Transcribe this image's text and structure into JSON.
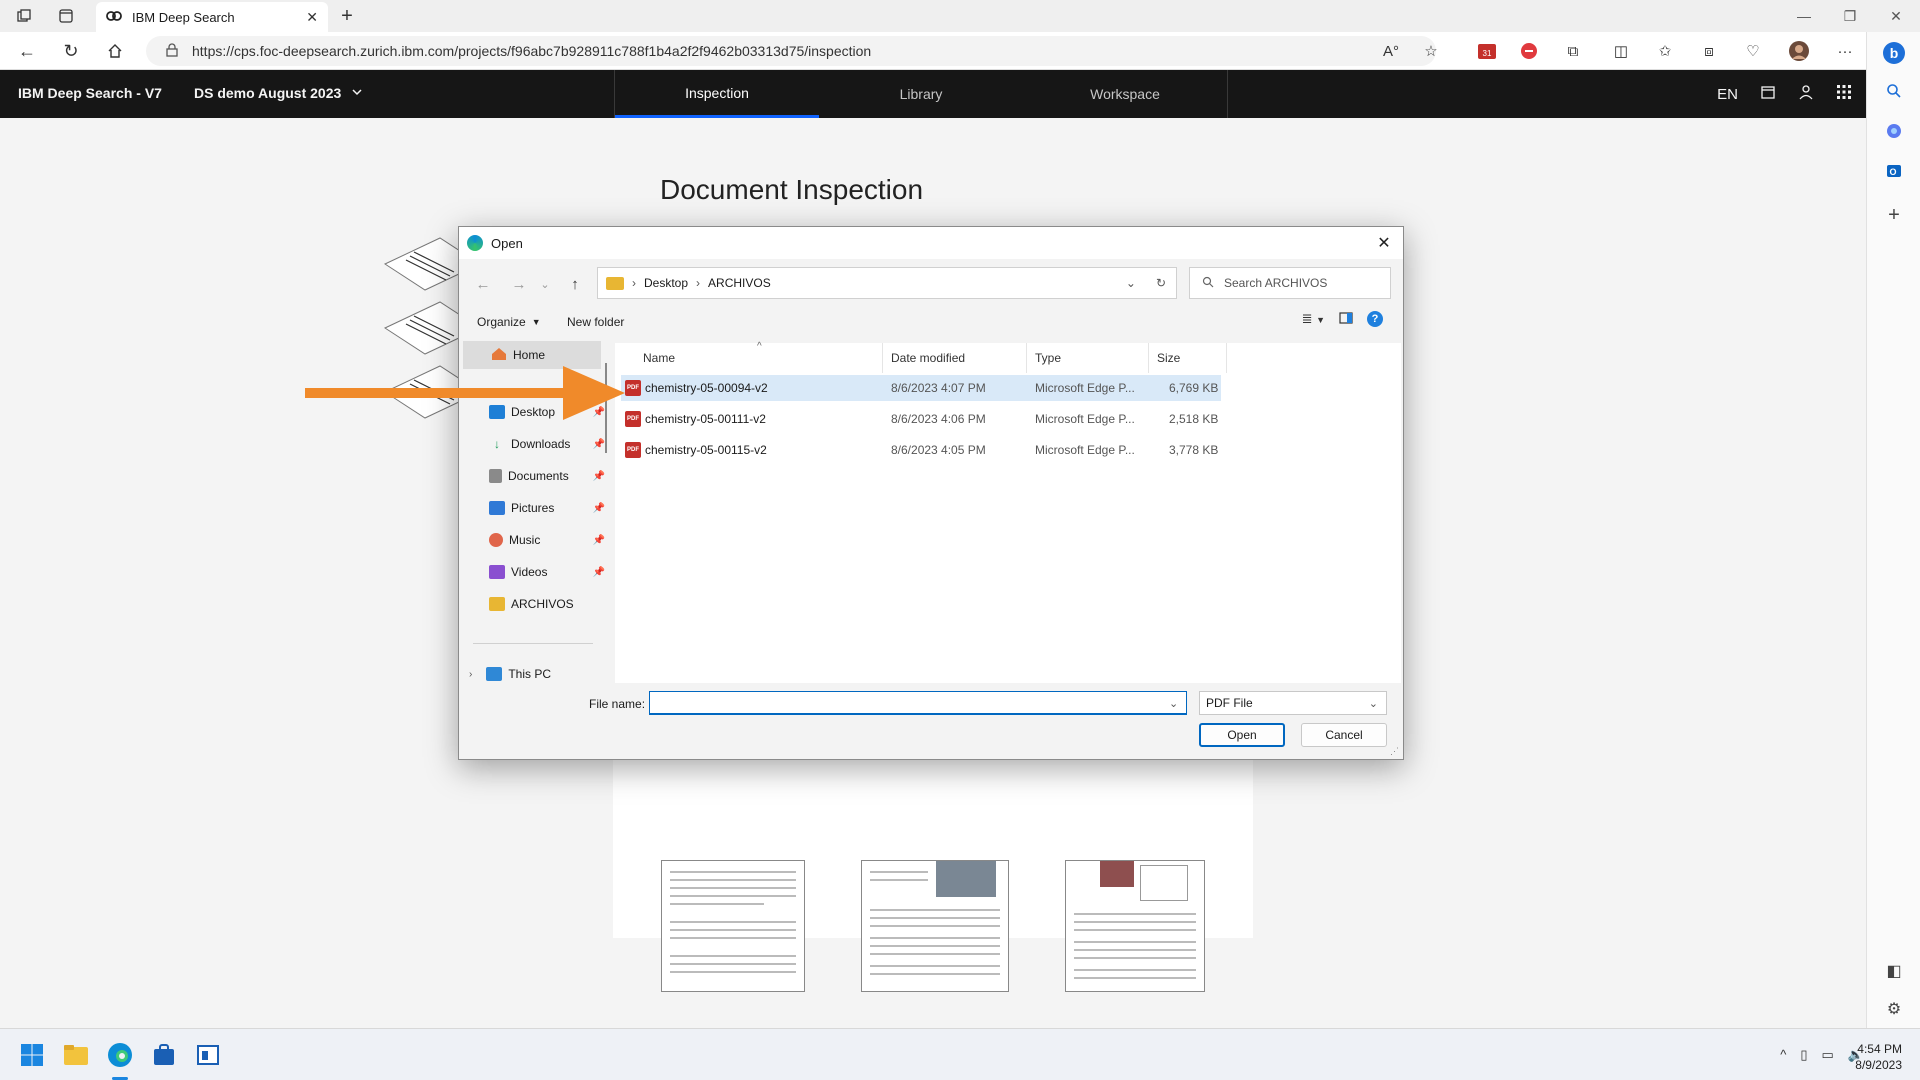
{
  "browser": {
    "tab_title": "IBM Deep Search",
    "url": "https://cps.foc-deepsearch.zurich.ibm.com/projects/f96abc7b928911c788f1b4a2f2f9462b03313d75/inspection"
  },
  "app": {
    "brand": "IBM Deep Search - V7",
    "project": "DS demo August 2023",
    "nav": [
      "Inspection",
      "Library",
      "Workspace"
    ],
    "active_nav": "Inspection",
    "lang": "EN"
  },
  "page": {
    "title": "Document Inspection"
  },
  "dialog": {
    "title": "Open",
    "breadcrumb": [
      "Desktop",
      "ARCHIVOS"
    ],
    "search_placeholder": "Search ARCHIVOS",
    "toolbar": {
      "organize": "Organize",
      "new_folder": "New folder"
    },
    "nav_home": "Home",
    "nav_items": [
      {
        "label": "Desktop",
        "color": "#1e7fd6"
      },
      {
        "label": "Downloads",
        "color": "#1e9b5a"
      },
      {
        "label": "Documents",
        "color": "#8a8a8a"
      },
      {
        "label": "Pictures",
        "color": "#2f79d6"
      },
      {
        "label": "Music",
        "color": "#e0654a"
      },
      {
        "label": "Videos",
        "color": "#8a4fd0"
      },
      {
        "label": "ARCHIVOS",
        "color": "#e8b633"
      }
    ],
    "this_pc": "This PC",
    "columns": [
      "Name",
      "Date modified",
      "Type",
      "Size"
    ],
    "files": [
      {
        "name": "chemistry-05-00094-v2",
        "date": "8/6/2023 4:07 PM",
        "type": "Microsoft Edge P...",
        "size": "6,769 KB",
        "selected": true
      },
      {
        "name": "chemistry-05-00111-v2",
        "date": "8/6/2023 4:06 PM",
        "type": "Microsoft Edge P...",
        "size": "2,518 KB",
        "selected": false
      },
      {
        "name": "chemistry-05-00115-v2",
        "date": "8/6/2023 4:05 PM",
        "type": "Microsoft Edge P...",
        "size": "3,778 KB",
        "selected": false
      }
    ],
    "file_name_label": "File name:",
    "file_name_value": "",
    "file_type": "PDF File",
    "open_button": "Open",
    "cancel_button": "Cancel",
    "pdf_badge": "PDF"
  },
  "taskbar": {
    "time": "4:54 PM",
    "date": "8/9/2023"
  },
  "colors": {
    "arrow": "#f08a2a",
    "accent": "#0f62fe"
  }
}
